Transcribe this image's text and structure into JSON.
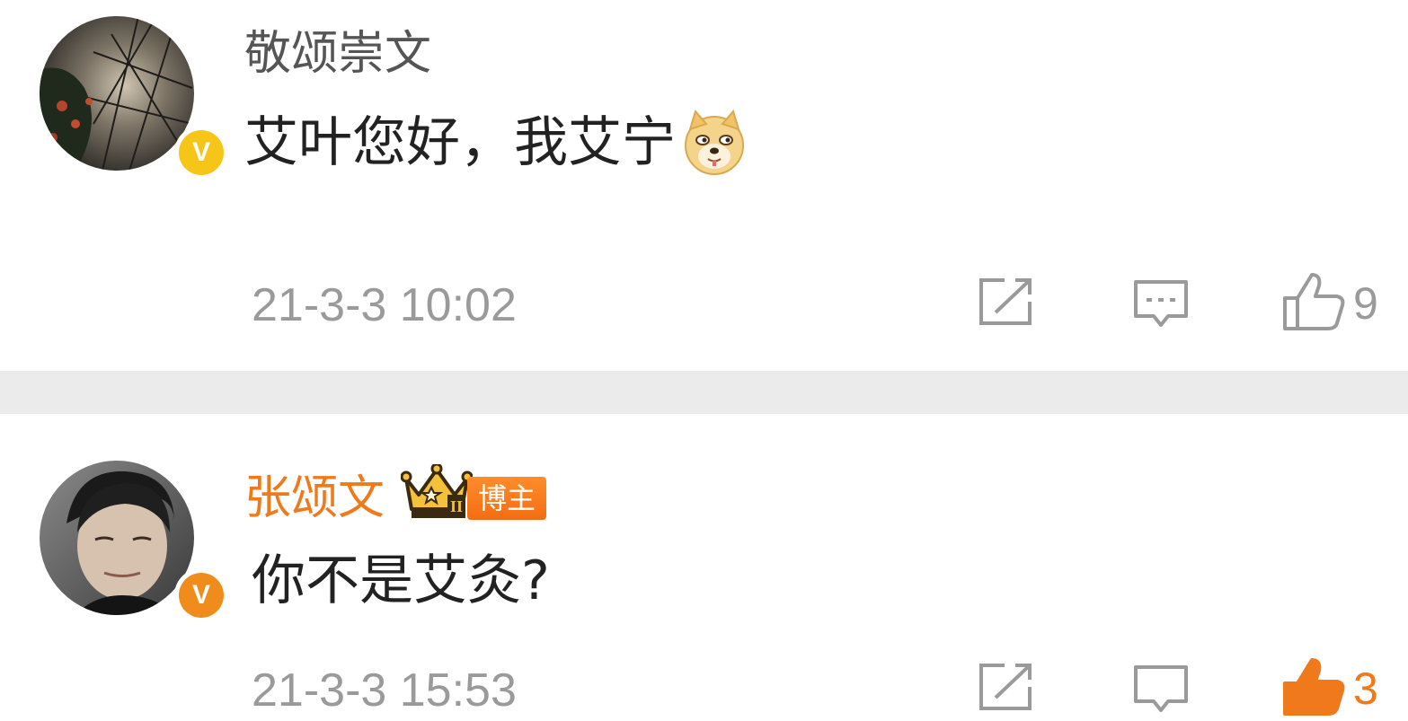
{
  "comments": [
    {
      "username": "敬颂崇文",
      "username_color": "#555555",
      "verified_badge_color": "#f5c518",
      "verified_glyph": "V",
      "text": "艾叶您好，我艾宁",
      "emoji": "doge-emoji",
      "timestamp": "21-3-3 10:02",
      "like_count": "9"
    },
    {
      "username": "张颂文",
      "username_color": "#f07a1b",
      "verified_badge_color": "#f08c1b",
      "verified_glyph": "V",
      "badge_label": "博主",
      "badge_level": "II",
      "text": "你不是艾灸?",
      "timestamp": "21-3-3 15:53",
      "like_count": "3"
    }
  ],
  "icons": {
    "repost": "repost-icon",
    "comment": "comment-icon",
    "like": "thumbs-up-icon"
  }
}
